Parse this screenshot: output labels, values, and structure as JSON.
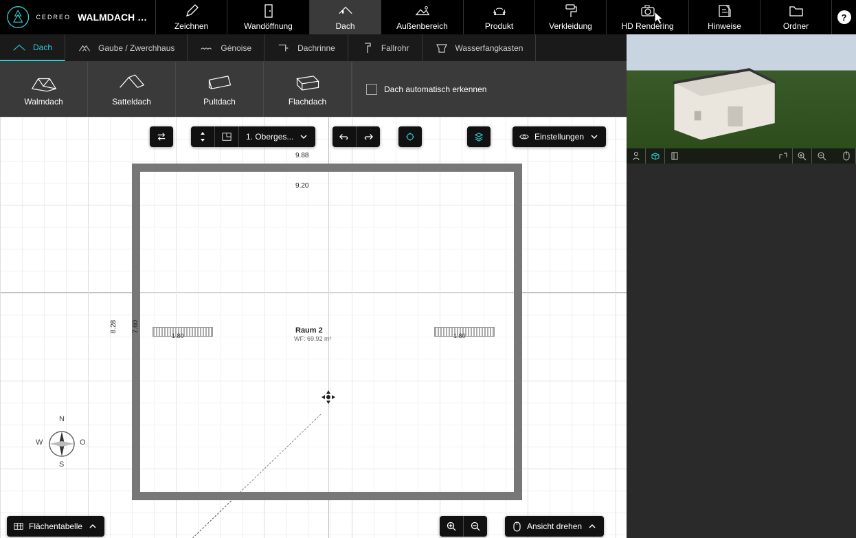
{
  "app": {
    "name": "CEDREO",
    "project_title": "WALMDACH MI..."
  },
  "topnav": {
    "items": [
      {
        "label": "Zeichnen",
        "icon": "pencil-icon"
      },
      {
        "label": "Wandöffnung",
        "icon": "door-icon"
      },
      {
        "label": "Dach",
        "icon": "roof-main-icon",
        "active": true
      },
      {
        "label": "Außenbereich",
        "icon": "terrain-icon"
      },
      {
        "label": "Produkt",
        "icon": "furniture-icon"
      },
      {
        "label": "Verkleidung",
        "icon": "paint-roller-icon"
      },
      {
        "label": "HD Rendering",
        "icon": "camera-icon"
      },
      {
        "label": "Hinweise",
        "icon": "note-icon"
      },
      {
        "label": "Ordner",
        "icon": "folder-icon"
      }
    ]
  },
  "subtabs": {
    "items": [
      {
        "label": "Dach",
        "active": true
      },
      {
        "label": "Gaube / Zwerchhaus"
      },
      {
        "label": "Génoise"
      },
      {
        "label": "Dachrinne"
      },
      {
        "label": "Fallrohr"
      },
      {
        "label": "Wasserfangkasten"
      }
    ]
  },
  "roof_types": {
    "items": [
      {
        "label": "Walmdach"
      },
      {
        "label": "Satteldach"
      },
      {
        "label": "Pultdach"
      },
      {
        "label": "Flachdach"
      }
    ],
    "auto_detect_label": "Dach automatisch erkennen"
  },
  "canvas": {
    "floor_selector": "1. Oberges...",
    "settings_label": "Einstellungen",
    "dim_outer_w": "9.88",
    "dim_inner_w": "9.20",
    "dim_outer_h": "8.28",
    "dim_inner_h": "7.60",
    "room_name": "Raum 2",
    "room_area": "WF: 69.92 m²",
    "window_left_w": "1.80",
    "window_right_w": "1.80",
    "compass_n": "N",
    "compass_s": "S",
    "compass_o": "O",
    "compass_w": "W"
  },
  "bottom": {
    "area_table": "Flächentabelle",
    "rotate_view": "Ansicht drehen"
  }
}
